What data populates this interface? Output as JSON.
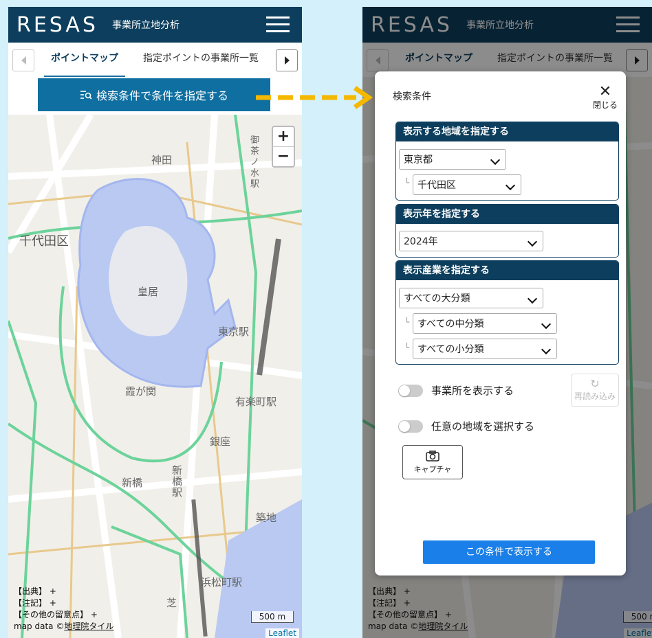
{
  "app": {
    "logo": "RESAS",
    "title": "事業所立地分析"
  },
  "tabs": [
    {
      "label": "ポイントマップ",
      "active": true
    },
    {
      "label": "指定ポイントの事業所一覧",
      "active": false
    }
  ],
  "search_button": {
    "label": "検索条件で条件を指定する"
  },
  "map": {
    "labels": [
      "千代田区",
      "皇居",
      "東京駅",
      "霞が関",
      "有楽町駅",
      "銀座",
      "新橋",
      "新橋駅",
      "築地",
      "神田",
      "御茶ノ水駅",
      "浜松町駅",
      "芝"
    ],
    "zoom_in": "+",
    "zoom_out": "−",
    "attribution": [
      "【出典】 +",
      "【注記】 +",
      "【その他の留意点】 +"
    ],
    "map_data_prefix": "map data ©",
    "map_data_link": "地理院タイル",
    "scale": "500 m",
    "leaflet": "Leaflet"
  },
  "modal": {
    "title": "検索条件",
    "close_label": "閉じる",
    "region_section": {
      "heading": "表示する地域を指定する",
      "prefecture": "東京都",
      "city": "千代田区"
    },
    "year_section": {
      "heading": "表示年を指定する",
      "year": "2024年"
    },
    "industry_section": {
      "heading": "表示産業を指定する",
      "major": "すべての大分類",
      "middle": "すべての中分類",
      "minor": "すべての小分類"
    },
    "toggle_offices": "事業所を表示する",
    "toggle_region": "任意の地域を選択する",
    "reload_label": "再読み込み",
    "capture_label": "キャプチャ",
    "submit_label": "この条件で表示する"
  },
  "colors": {
    "header": "#0d3e5d",
    "button": "#0f6fa0",
    "submit": "#1a7fe8",
    "arrow": "#f5b800",
    "background": "#d3f0fb"
  }
}
